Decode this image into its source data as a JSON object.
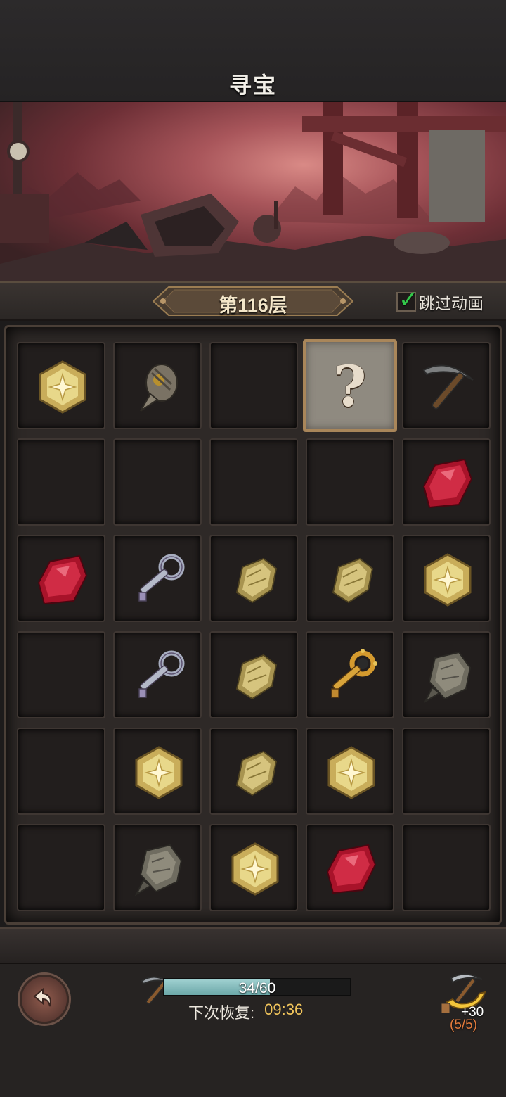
{
  "header": {
    "title": "寻宝"
  },
  "floor": {
    "label": "第116层"
  },
  "skip_animation": {
    "label": "跳过动画",
    "checked": true
  },
  "board": {
    "rows": [
      [
        "star-gem",
        "drill-ore",
        "empty",
        "mystery",
        "pickaxe"
      ],
      [
        "empty",
        "empty",
        "empty",
        "empty",
        "red-ruby"
      ],
      [
        "red-ruby",
        "silver-key",
        "gold-ore",
        "gold-ore",
        "star-gem"
      ],
      [
        "empty",
        "silver-key",
        "gold-ore",
        "gold-key",
        "stone-ore"
      ],
      [
        "empty",
        "star-gem",
        "gold-ore",
        "star-gem",
        "empty"
      ],
      [
        "empty",
        "stone-ore",
        "star-gem",
        "red-ruby",
        "empty"
      ]
    ],
    "mystery_symbol": "?"
  },
  "energy": {
    "current": 34,
    "max": 60,
    "text": "34/60",
    "fill_fraction": 0.567
  },
  "recovery": {
    "label": "下次恢复:",
    "time": "09:36"
  },
  "bonus": {
    "plus": "+30",
    "count": "(5/5)"
  },
  "icons": {
    "back": "back-arrow-icon",
    "energy": "pickaxe-icon",
    "bonus": "pickaxe-refill-icon"
  },
  "colors": {
    "accent_gold": "#f0c45b",
    "check_green": "#33c74a",
    "bonus_orange": "#e37b3c",
    "energy_fill": "#6ba7a8"
  }
}
